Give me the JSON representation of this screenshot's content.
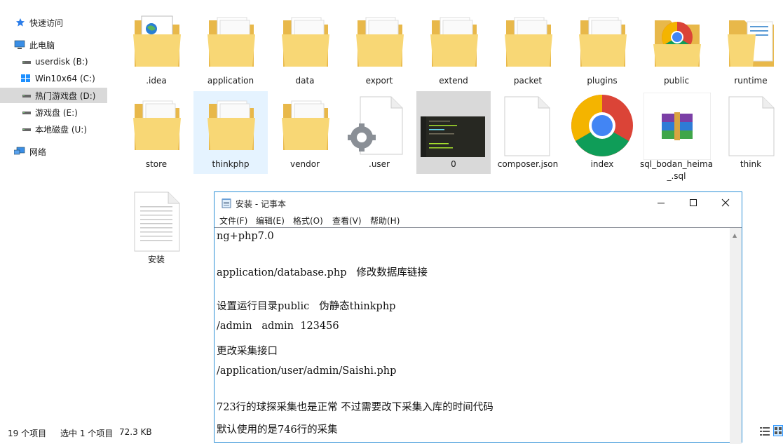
{
  "sidebar": {
    "items": [
      {
        "label": "快速访问",
        "icon": "star-icon"
      },
      {
        "label": "此电脑",
        "icon": "computer-icon"
      },
      {
        "label": "userdisk (B:)",
        "icon": "drive-icon"
      },
      {
        "label": "Win10x64 (C:)",
        "icon": "windows-drive-icon"
      },
      {
        "label": "热门游戏盘 (D:)",
        "icon": "drive-icon"
      },
      {
        "label": "游戏盘 (E:)",
        "icon": "drive-icon"
      },
      {
        "label": "本地磁盘 (U:)",
        "icon": "drive-icon"
      },
      {
        "label": "网络",
        "icon": "network-icon"
      }
    ]
  },
  "files": [
    {
      "name": ".idea",
      "icon": "folder-with-web-page-icon"
    },
    {
      "name": "application",
      "icon": "folder-icon"
    },
    {
      "name": "data",
      "icon": "folder-icon"
    },
    {
      "name": "export",
      "icon": "folder-icon"
    },
    {
      "name": "extend",
      "icon": "folder-icon"
    },
    {
      "name": "packet",
      "icon": "folder-icon"
    },
    {
      "name": "plugins",
      "icon": "folder-icon"
    },
    {
      "name": "public",
      "icon": "folder-with-chrome-icon"
    },
    {
      "name": "runtime",
      "icon": "folder-icon"
    },
    {
      "name": "store",
      "icon": "folder-icon"
    },
    {
      "name": "thinkphp",
      "icon": "folder-icon"
    },
    {
      "name": "vendor",
      "icon": "folder-icon"
    },
    {
      "name": ".user",
      "icon": "settings-file-icon"
    },
    {
      "name": "0",
      "icon": "image-thumbnail-icon"
    },
    {
      "name": "composer.json",
      "icon": "blank-file-icon"
    },
    {
      "name": "index",
      "icon": "chrome-icon"
    },
    {
      "name": "sql_bodan_heima_.sql",
      "icon": "winrar-archive-icon"
    },
    {
      "name": "think",
      "icon": "blank-file-icon"
    },
    {
      "name": "安装",
      "icon": "text-file-icon"
    }
  ],
  "status": {
    "count": "19 个项目",
    "selected": "选中 1 个项目",
    "size": "72.3 KB"
  },
  "notepad": {
    "title": "安装 - 记事本",
    "menu": [
      "文件(F)",
      "编辑(E)",
      "格式(O)",
      "查看(V)",
      "帮助(H)"
    ],
    "lines": [
      "ng+php7.0",
      "application/database.php   修改数据库链接",
      "设置运行目录public   伪静态thinkphp",
      "/admin   admin  123456",
      "更改采集接口",
      "/application/user/admin/Saishi.php",
      "723行的球探采集也是正常 不过需要改下采集入库的时间代码",
      "默认使用的是746行的采集"
    ]
  },
  "colors": {
    "folder": "#f8d775",
    "folder_dark": "#e8b84a",
    "selection": "#cce8ff",
    "window_border": "#2b8fd6"
  }
}
